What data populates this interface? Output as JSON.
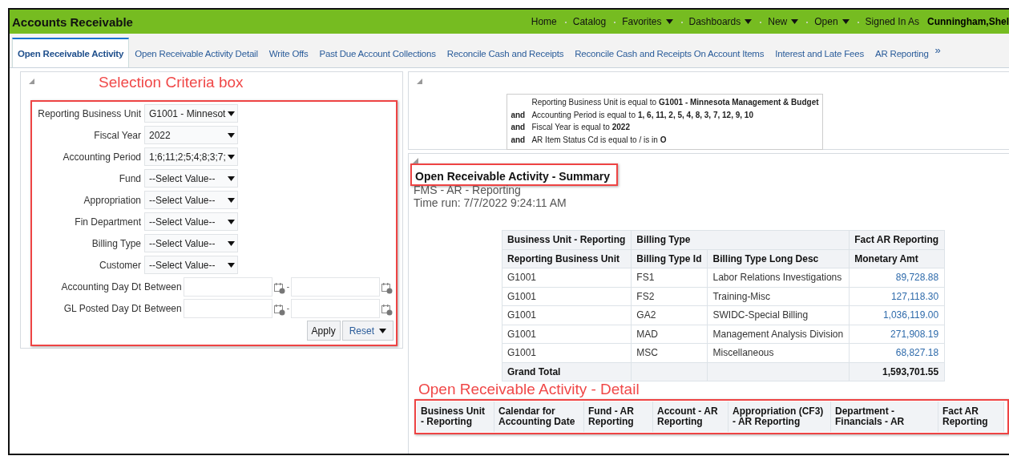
{
  "header": {
    "title": "Accounts Receivable",
    "menu": [
      {
        "label": "Home",
        "dropdown": false
      },
      {
        "label": "Catalog",
        "dropdown": false
      },
      {
        "label": "Favorites",
        "dropdown": true
      },
      {
        "label": "Dashboards",
        "dropdown": true
      },
      {
        "label": "New",
        "dropdown": true
      },
      {
        "label": "Open",
        "dropdown": true
      }
    ],
    "signed_in_label": "Signed In As",
    "user": "Cunningham,Shel"
  },
  "tabs": [
    {
      "label": "Open Receivable Activity",
      "selected": true
    },
    {
      "label": "Open Receivable Activity Detail",
      "selected": false
    },
    {
      "label": "Write Offs",
      "selected": false
    },
    {
      "label": "Past Due Account Collections",
      "selected": false
    },
    {
      "label": "Reconcile Cash and Receipts",
      "selected": false
    },
    {
      "label": "Reconcile Cash and Receipts On Account Items",
      "selected": false
    },
    {
      "label": "Interest and Late Fees",
      "selected": false
    },
    {
      "label": "AR Reporting",
      "selected": false
    }
  ],
  "tabs_more": "»",
  "selection_annotation": "Selection Criteria box",
  "prompts": [
    {
      "kind": "select",
      "label": "Reporting Business Unit",
      "value": "G1001 - Minnesot"
    },
    {
      "kind": "select",
      "label": "Fiscal Year",
      "value": "2022"
    },
    {
      "kind": "select",
      "label": "Accounting Period",
      "value": "1;6;11;2;5;4;8;3;7;"
    },
    {
      "kind": "select",
      "label": "Fund",
      "value": "--Select Value--"
    },
    {
      "kind": "select",
      "label": "Appropriation",
      "value": "--Select Value--"
    },
    {
      "kind": "select",
      "label": "Fin Department",
      "value": "--Select Value--"
    },
    {
      "kind": "select",
      "label": "Billing Type",
      "value": "--Select Value--"
    },
    {
      "kind": "select",
      "label": "Customer",
      "value": "--Select Value--"
    },
    {
      "kind": "date_range",
      "label": "Accounting Day Dt",
      "operator": "Between",
      "separator": "-"
    },
    {
      "kind": "date_range",
      "label": "GL Posted Day Dt",
      "operator": "Between",
      "separator": "-"
    }
  ],
  "buttons": [
    {
      "kind": "plain",
      "label": "Apply"
    },
    {
      "kind": "menu",
      "label": "Reset"
    }
  ],
  "filters": [
    {
      "text": "Reporting Business Unit is equal to",
      "value": "G1001 - Minnesota Management & Budget"
    },
    {
      "conjunction": "and",
      "text": "Accounting Period is equal to",
      "value": "1, 6, 11, 2, 5, 4, 8, 3, 7, 12, 9, 10"
    },
    {
      "conjunction": "and",
      "text": "Fiscal Year is equal to",
      "value": "2022"
    },
    {
      "conjunction": "and",
      "text": "AR Item Status Cd is equal to / is in",
      "value": "O"
    }
  ],
  "summary": {
    "title": "Open Receivable Activity - Summary",
    "subtitle": "FMS - AR - Reporting",
    "time_run": "Time run: 7/7/2022 9:24:11 AM",
    "group_headers": [
      "Business Unit - Reporting",
      "Billing Type",
      "Fact AR Reporting"
    ],
    "columns": [
      "Reporting Business Unit",
      "Billing Type Id",
      "Billing Type Long Desc",
      "Monetary Amt"
    ],
    "rows": [
      [
        "G1001",
        "FS1",
        "Labor Relations Investigations",
        "89,728.88"
      ],
      [
        "G1001",
        "FS2",
        "Training-Misc",
        "127,118.30"
      ],
      [
        "G1001",
        "GA2",
        "SWIDC-Special Billing",
        "1,036,119.00"
      ],
      [
        "G1001",
        "MAD",
        "Management Analysis Division",
        "271,908.19"
      ],
      [
        "G1001",
        "MSC",
        "Miscellaneous",
        "68,827.18"
      ]
    ],
    "total_label": "Grand Total",
    "total_amount": "1,593,701.55"
  },
  "detail": {
    "annotation": "Open Receivable Activity - Detail",
    "columns": [
      "Business Unit - Reporting",
      "Calendar for Accounting Date",
      "Fund - AR Reporting",
      "Account - AR Reporting",
      "Appropriation (CF3) - AR Reporting",
      "Department - Financials - AR",
      "Fact AR Reporting"
    ]
  }
}
